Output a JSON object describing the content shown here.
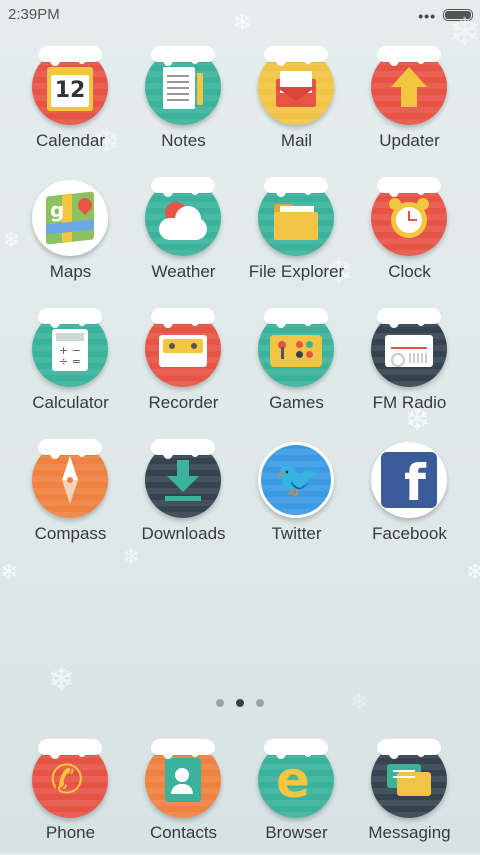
{
  "status_bar": {
    "time": "2:39PM",
    "overflow": "•••"
  },
  "apps": [
    {
      "label": "Calendar",
      "date": "12"
    },
    {
      "label": "Notes"
    },
    {
      "label": "Mail"
    },
    {
      "label": "Updater"
    },
    {
      "label": "Maps"
    },
    {
      "label": "Weather"
    },
    {
      "label": "File Explorer"
    },
    {
      "label": "Clock"
    },
    {
      "label": "Calculator"
    },
    {
      "label": "Recorder"
    },
    {
      "label": "Games"
    },
    {
      "label": "FM Radio"
    },
    {
      "label": "Compass"
    },
    {
      "label": "Downloads"
    },
    {
      "label": "Twitter"
    },
    {
      "label": "Facebook"
    }
  ],
  "pager": {
    "pages": 3,
    "active_index": 1
  },
  "dock": [
    {
      "label": "Phone"
    },
    {
      "label": "Contacts"
    },
    {
      "label": "Browser"
    },
    {
      "label": "Messaging"
    }
  ],
  "colors": {
    "red": "#e65446",
    "teal": "#3bb39c",
    "yellow": "#f2c445",
    "navy": "#34434f",
    "orange": "#ef8240",
    "white": "#ffffff"
  }
}
